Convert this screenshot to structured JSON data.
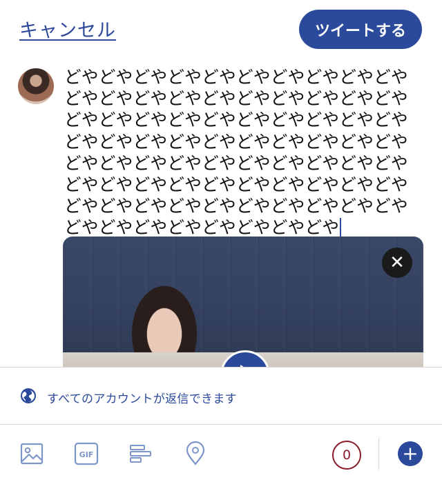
{
  "header": {
    "cancel_label": "キャンセル",
    "tweet_label": "ツイートする"
  },
  "compose": {
    "text": "どやどやどやどやどやどやどやどやどやどやどやどやどやどやどやどやどやどやどやどやどやどやどやどやどやどやどやどやどやどやどやどやどやどやどやどやどやどやどやどやどやどやどやどやどやどやどやどやどやどやどやどやどやどやどやどやどやどやどやどやどやどやどやどやどやどやどやどやどやどやどやどやどやどやどやどやどやどや"
  },
  "media": {
    "close_glyph": "✕"
  },
  "reply_setting": {
    "label": "すべてのアカウントが返信できます"
  },
  "toolbar": {
    "icons": [
      "image-icon",
      "gif-icon",
      "poll-icon",
      "location-icon"
    ],
    "gif_label": "GIF",
    "char_counter": "0",
    "add_glyph": "+"
  },
  "colors": {
    "accent": "#2b4a9b",
    "counter": "#8a1c2b"
  }
}
